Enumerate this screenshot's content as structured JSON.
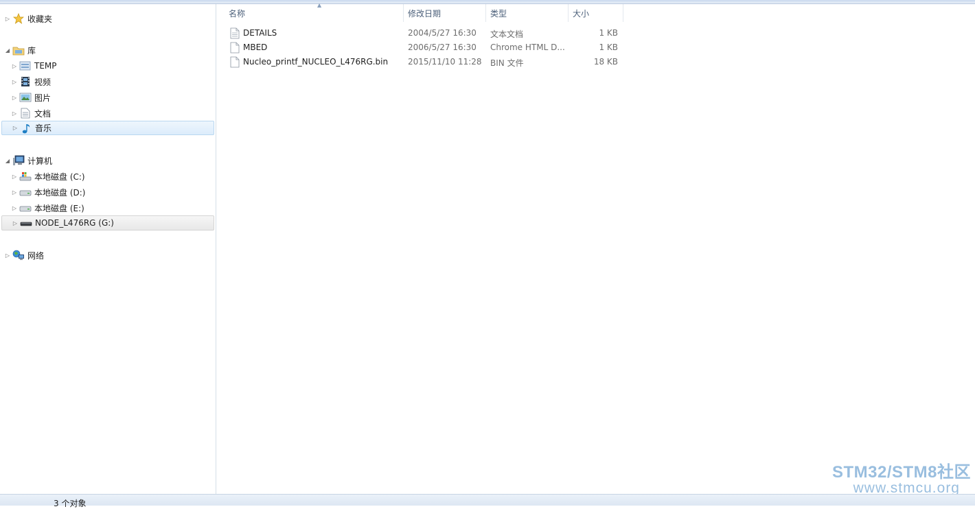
{
  "nav": {
    "favorites": {
      "label": "收藏夹",
      "icon": "star-icon"
    },
    "libraries": {
      "label": "库",
      "icon": "library-folder-icon",
      "items": [
        {
          "label": "TEMP",
          "icon": "library-icon"
        },
        {
          "label": "视频",
          "icon": "video-film-icon"
        },
        {
          "label": "图片",
          "icon": "picture-icon"
        },
        {
          "label": "文档",
          "icon": "document-icon"
        },
        {
          "label": "音乐",
          "icon": "music-note-icon"
        }
      ]
    },
    "computer": {
      "label": "计算机",
      "icon": "computer-icon",
      "items": [
        {
          "label": "本地磁盘 (C:)",
          "icon": "system-drive-icon"
        },
        {
          "label": "本地磁盘 (D:)",
          "icon": "hard-drive-icon"
        },
        {
          "label": "本地磁盘 (E:)",
          "icon": "hard-drive-icon"
        },
        {
          "label": "NODE_L476RG (G:)",
          "icon": "removable-drive-icon"
        }
      ]
    },
    "network": {
      "label": "网络",
      "icon": "network-icon"
    }
  },
  "columns": {
    "name": "名称",
    "modified": "修改日期",
    "type": "类型",
    "size": "大小"
  },
  "files": [
    {
      "name": "DETAILS",
      "modified": "2004/5/27 16:30",
      "type": "文本文档",
      "size": "1 KB",
      "icon": "text-file-icon"
    },
    {
      "name": "MBED",
      "modified": "2006/5/27 16:30",
      "type": "Chrome HTML D...",
      "size": "1 KB",
      "icon": "html-file-icon"
    },
    {
      "name": "Nucleo_printf_NUCLEO_L476RG.bin",
      "modified": "2015/11/10 11:28",
      "type": "BIN 文件",
      "size": "18 KB",
      "icon": "bin-file-icon"
    }
  ],
  "status": {
    "count": "3 个对象"
  },
  "watermark": {
    "line1": "STM32/STM8社区",
    "line2": "www.stmcu.org"
  },
  "colors": {
    "selection": "#dcecfb",
    "header_text": "#4c607a",
    "watermark": "#8fb8dc"
  }
}
